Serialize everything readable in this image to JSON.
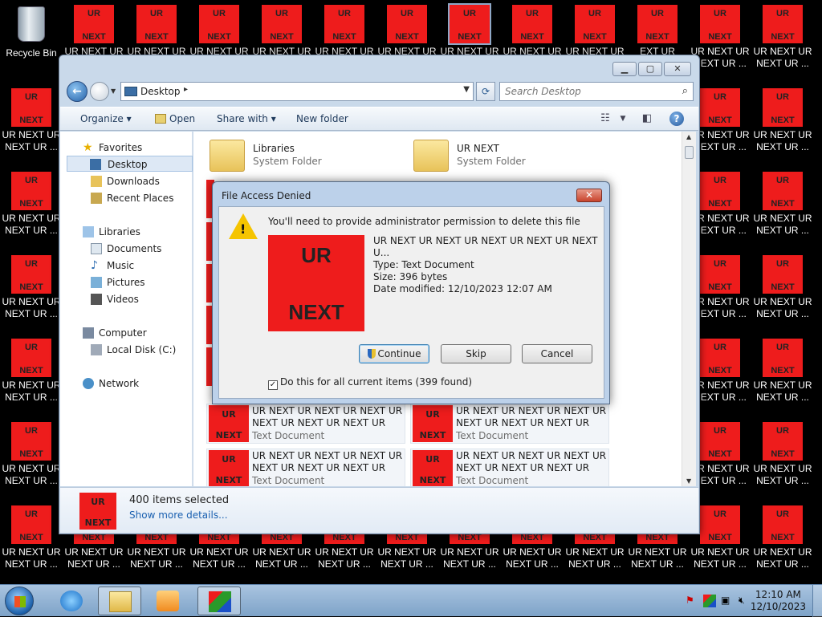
{
  "desktop": {
    "recycle_bin": "Recycle Bin",
    "icon_top": "UR",
    "icon_bottom": "NEXT",
    "icon_label": "UR NEXT UR\nNEXT UR ...",
    "partial_label": "EXT UR"
  },
  "explorer": {
    "address": "Desktop",
    "search_placeholder": "Search Desktop",
    "commands": {
      "organize": "Organize",
      "open": "Open",
      "share": "Share with",
      "new_folder": "New folder"
    },
    "nav": {
      "favorites": "Favorites",
      "desktop": "Desktop",
      "downloads": "Downloads",
      "recent": "Recent Places",
      "libraries": "Libraries",
      "documents": "Documents",
      "music": "Music",
      "pictures": "Pictures",
      "videos": "Videos",
      "computer": "Computer",
      "local_disk": "Local Disk (C:)",
      "network": "Network"
    },
    "folders": [
      {
        "name": "Libraries",
        "type": "System Folder"
      },
      {
        "name": "UR NEXT",
        "type": "System Folder"
      }
    ],
    "file_name": "UR NEXT UR NEXT UR NEXT UR\nNEXT UR NEXT UR NEXT UR NEX...",
    "file_type": "Text Document",
    "details": {
      "count": "400 items selected",
      "more": "Show more details..."
    }
  },
  "dialog": {
    "title": "File Access Denied",
    "close": "✕",
    "message": "You'll need to provide administrator permission to delete this file",
    "thumb_top": "UR",
    "thumb_bottom": "NEXT",
    "file_name": "UR NEXT UR NEXT UR NEXT UR NEXT UR NEXT U...",
    "file_type": "Type: Text Document",
    "file_size": "Size: 396 bytes",
    "file_date": "Date modified: 12/10/2023 12:07 AM",
    "continue": "Continue",
    "skip": "Skip",
    "cancel": "Cancel",
    "checkbox": "Do this for all current items (399 found)",
    "checked": true
  },
  "taskbar": {
    "time": "12:10 AM",
    "date": "12/10/2023"
  },
  "colors": {
    "ur_red": "#ee1c1c",
    "desktop_bg": "#000000",
    "window_frame": "#c9d9ea"
  }
}
